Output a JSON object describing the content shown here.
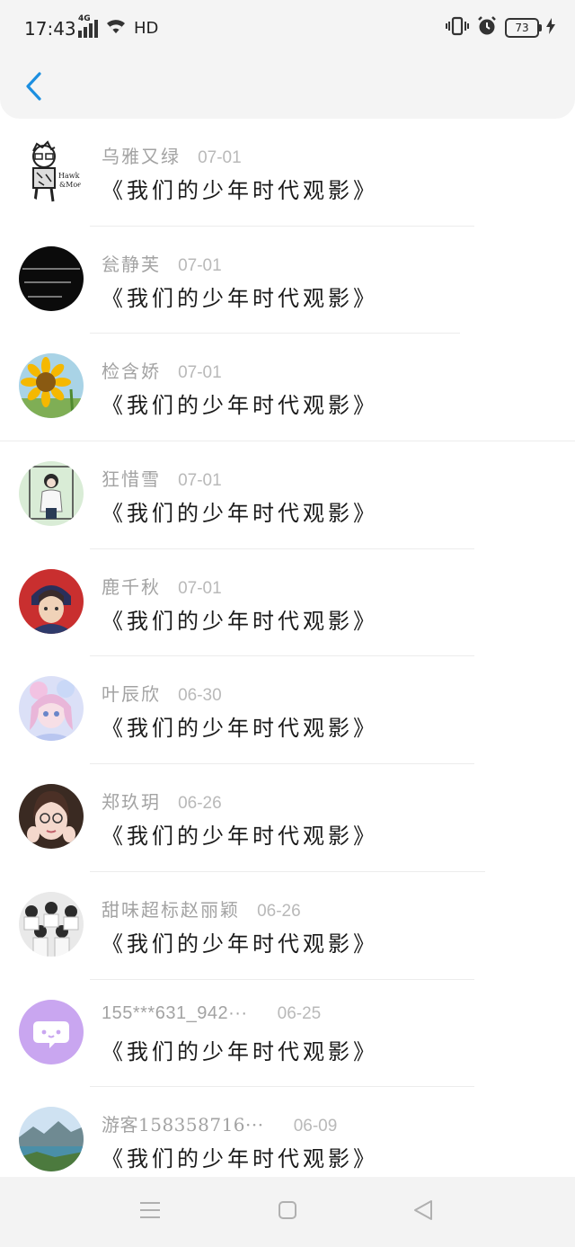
{
  "status_bar": {
    "time": "17:43",
    "network": "4G",
    "hd": "HD",
    "battery": "73"
  },
  "colors": {
    "accent": "#1c8fe0",
    "name_gray": "#a3a3a3",
    "date_gray": "#b9b9b9",
    "title_black": "#1a1a1a"
  },
  "header": {
    "back_icon": "chevron-left-icon"
  },
  "comments": [
    {
      "name": "乌雅又绿",
      "date": "07-01",
      "title": "《我们的少年时代观影》",
      "avatar": "cartoon-sketch"
    },
    {
      "name": "瓮静芙",
      "date": "07-01",
      "title": "《我们的少年时代观影》",
      "avatar": "black-text"
    },
    {
      "name": "检含娇",
      "date": "07-01",
      "title": "《我们的少年时代观影》",
      "avatar": "sunflower"
    },
    {
      "name": "狂惜雪",
      "date": "07-01",
      "title": "《我们的少年时代观影》",
      "avatar": "girl-green"
    },
    {
      "name": "鹿千秋",
      "date": "07-01",
      "title": "《我们的少年时代观影》",
      "avatar": "anime-boy"
    },
    {
      "name": "叶辰欣",
      "date": "06-30",
      "title": "《我们的少年时代观影》",
      "avatar": "anime-girl-pink"
    },
    {
      "name": "郑玖玥",
      "date": "06-26",
      "title": "《我们的少年时代观影》",
      "avatar": "girl-portrait"
    },
    {
      "name": "甜味超标赵丽颖",
      "date": "06-26",
      "title": "《我们的少年时代观影》",
      "avatar": "group-photo"
    },
    {
      "name": "155***631_942···",
      "date": "06-25",
      "title": "《我们的少年时代观影》",
      "avatar": "chat-bubble"
    },
    {
      "name": "游客158358716···",
      "date": "06-09",
      "title": "《我们的少年时代观影》",
      "avatar": "landscape"
    }
  ],
  "nav_bar": {
    "menu_icon": "menu-icon",
    "home_icon": "home-square-icon",
    "back_icon": "back-triangle-icon"
  }
}
